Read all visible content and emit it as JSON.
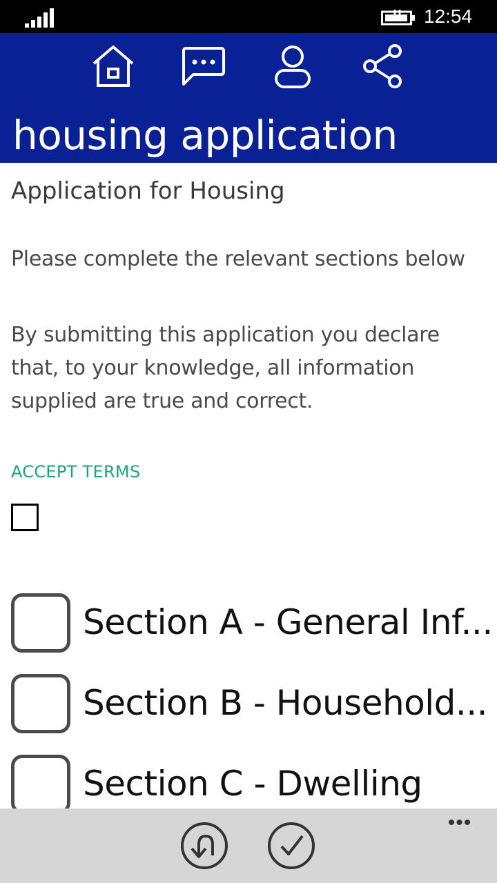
{
  "status_bar": {
    "time": "12:54",
    "icons": [
      "signal-strength-icon",
      "battery-charging-icon"
    ]
  },
  "header": {
    "title": "housing application",
    "nav_icons": [
      "home-icon",
      "chat-icon",
      "person-icon",
      "share-icon"
    ],
    "background_color": "#0a2195"
  },
  "form": {
    "heading": "Application for Housing",
    "instruction": "Please complete the relevant sections below",
    "declaration": "By submitting this application you declare that, to your knowledge, all information supplied are true and correct.",
    "accept_label": "ACCEPT TERMS",
    "accept_checked": false,
    "accent_color": "#18a775"
  },
  "sections": [
    {
      "label": "Section A - General Inf...",
      "checked": false
    },
    {
      "label": "Section B - Household...",
      "checked": false
    },
    {
      "label": "Section C - Dwelling",
      "checked": false
    }
  ],
  "app_bar": {
    "buttons": [
      "undo-icon",
      "check-icon"
    ],
    "more": "•••"
  }
}
